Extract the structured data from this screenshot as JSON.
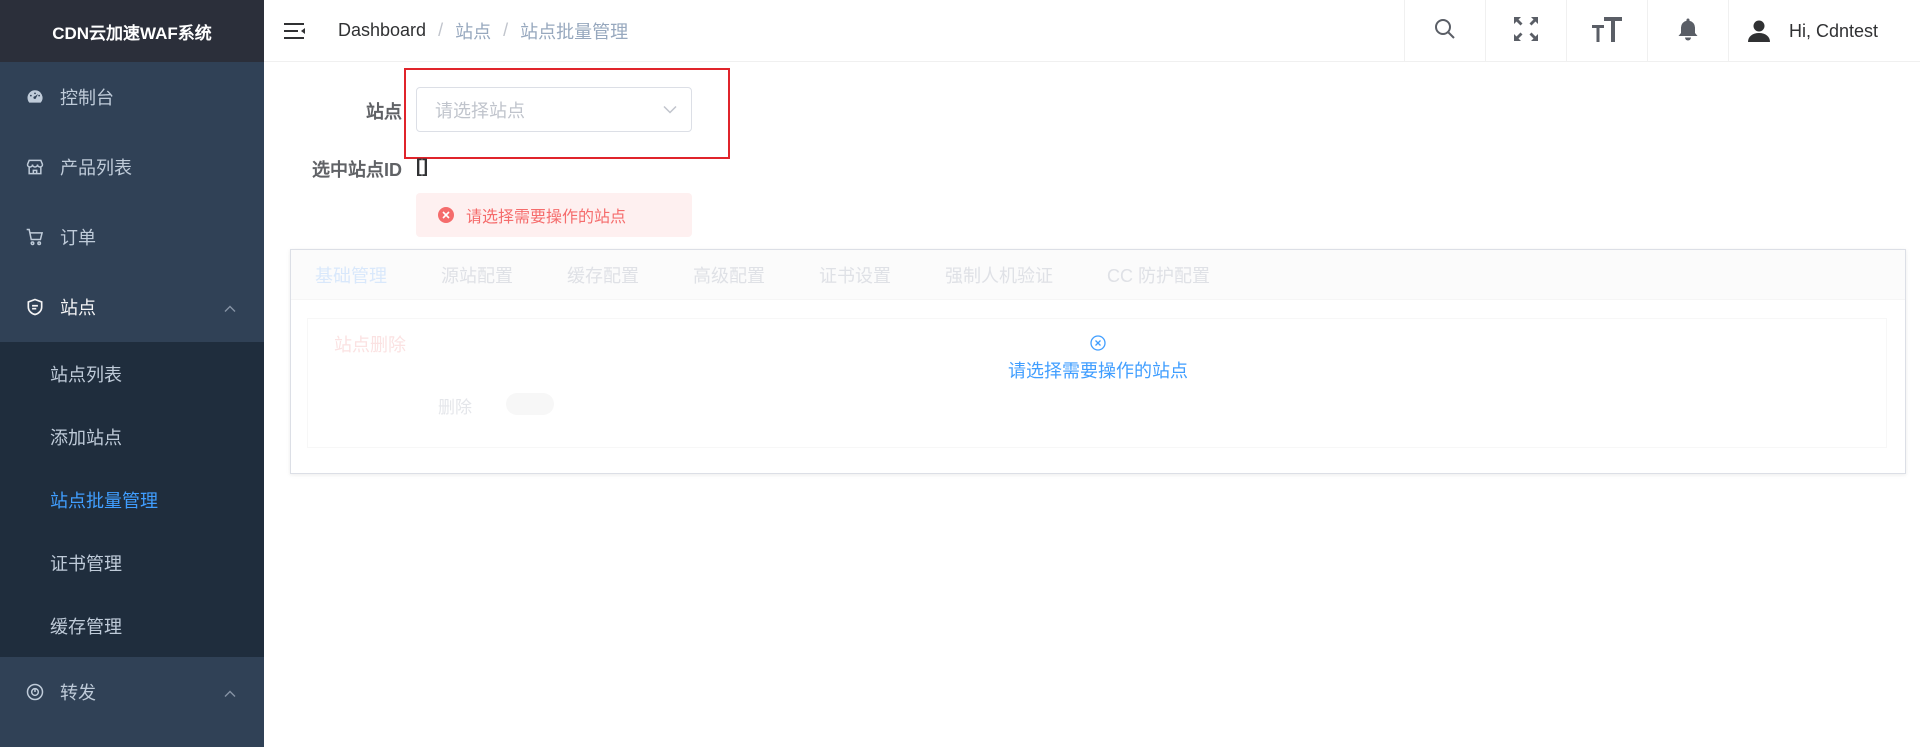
{
  "app": {
    "title": "CDN云加速WAF系统"
  },
  "sidebar": {
    "items": [
      {
        "label": "控制台",
        "icon": "dashboard-icon"
      },
      {
        "label": "产品列表",
        "icon": "store-icon"
      },
      {
        "label": "订单",
        "icon": "cart-icon"
      },
      {
        "label": "站点",
        "icon": "shield-icon",
        "expanded": true
      },
      {
        "label": "转发",
        "icon": "forward-icon",
        "expanded": true
      }
    ],
    "site_submenu": [
      {
        "label": "站点列表"
      },
      {
        "label": "添加站点"
      },
      {
        "label": "站点批量管理",
        "active": true
      },
      {
        "label": "证书管理"
      },
      {
        "label": "缓存管理"
      }
    ]
  },
  "header": {
    "breadcrumb": [
      "Dashboard",
      "站点",
      "站点批量管理"
    ],
    "separator": "/",
    "user_greeting": "Hi, Cdntest"
  },
  "form": {
    "site_label": "站点",
    "site_placeholder": "请选择站点",
    "selected_ids_label": "选中站点ID",
    "selected_ids_value": "[]",
    "alert_text": "请选择需要操作的站点"
  },
  "panel": {
    "tabs": [
      "基础管理",
      "源站配置",
      "缓存配置",
      "高级配置",
      "证书设置",
      "强制人机验证",
      "CC 防护配置"
    ],
    "active_tab": 0,
    "section_title": "站点删除",
    "delete_label": "删除",
    "overlay_message": "请选择需要操作的站点"
  },
  "colors": {
    "sidebar_bg": "#304156",
    "submenu_bg": "#1f2d3d",
    "accent": "#409eff",
    "error": "#f56c6c",
    "highlight_border": "#e0242b"
  }
}
